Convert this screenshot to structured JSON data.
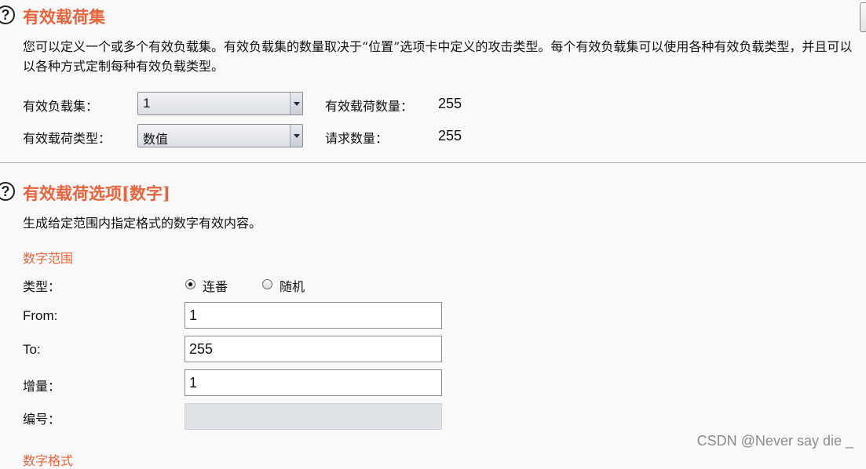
{
  "payload_sets": {
    "title": "有效载荷集",
    "description": "您可以定义一个或多个有效负载集。有效负载集的数量取决于“位置”选项卡中定义的攻击类型。每个有效负载集可以使用各种有效负载类型，并且可以以各种方式定制每种有效负载类型。",
    "payload_set_label": "有效负载集：",
    "payload_set_value": "1",
    "payload_type_label": "有效载荷类型：",
    "payload_type_value": "数值",
    "payload_count_label": "有效载荷数量：",
    "payload_count_value": "255",
    "request_count_label": "请求数量：",
    "request_count_value": "255"
  },
  "payload_options": {
    "title": "有效载荷选项[数字]",
    "description": "生成给定范围内指定格式的数字有效内容。",
    "number_range_heading": "数字范围",
    "type_label": "类型：",
    "radio_sequential_label": "连番",
    "radio_random_label": "随机",
    "selected_type": "连番",
    "from_label": "From:",
    "from_value": "1",
    "to_label": "To:",
    "to_value": "255",
    "step_label": "增量：",
    "step_value": "1",
    "how_many_label": "编号：",
    "how_many_value": "",
    "number_format_heading": "数字格式"
  },
  "icons": {
    "help": "help-icon",
    "help_glyph": "?"
  },
  "watermark": "CSDN @Never say die _",
  "colors": {
    "accent": "#e8643c",
    "background": "#f9f9f9",
    "disabled_field": "#dfe2e6"
  }
}
